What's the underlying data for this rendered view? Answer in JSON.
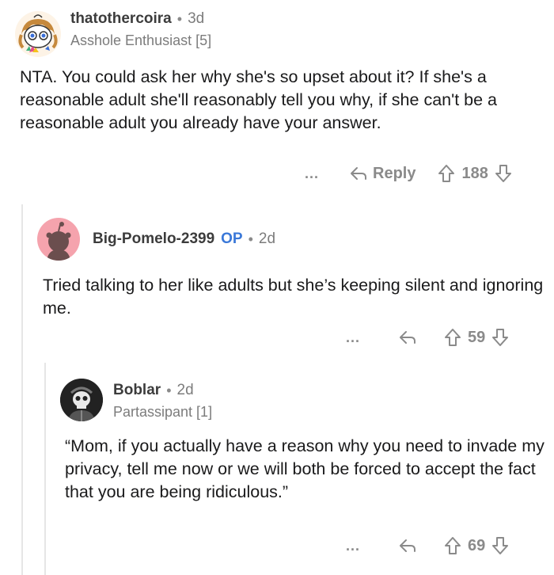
{
  "comments": [
    {
      "author": "thatothercoira",
      "time": "3d",
      "flair": "Asshole Enthusiast [5]",
      "body": "NTA. You could ask her why she's so upset about it? If she's a reasonable adult she'll reasonably tell you why, if she can't be a reasonable adult you already have your answer.",
      "more": "...",
      "reply_label": "Reply",
      "score": "188",
      "icons": [
        "more-icon",
        "reply-icon",
        "upvote-icon",
        "downvote-icon"
      ]
    },
    {
      "author": "Big-Pomelo-2399",
      "op_badge": "OP",
      "time": "2d",
      "body": "Tried talking to her like adults but she’s keeping silent and ignoring me.",
      "more": "...",
      "score": "59",
      "colors": {
        "avatar_bg": "#f5a3ad",
        "snoo": "#6b4e4e"
      }
    },
    {
      "author": "Boblar",
      "time": "2d",
      "flair": "Partassipant [1]",
      "body": "“Mom, if you actually have a reason why you need to invade my privacy, tell me now or we will both be forced to accept the fact that you are being ridiculous.”",
      "more": "...",
      "score": "69"
    }
  ],
  "separator": "•",
  "colors": {
    "op_badge": "#3a78d8",
    "thread_line": "#e6e6e6",
    "meta_text": "#7c7c7c"
  }
}
